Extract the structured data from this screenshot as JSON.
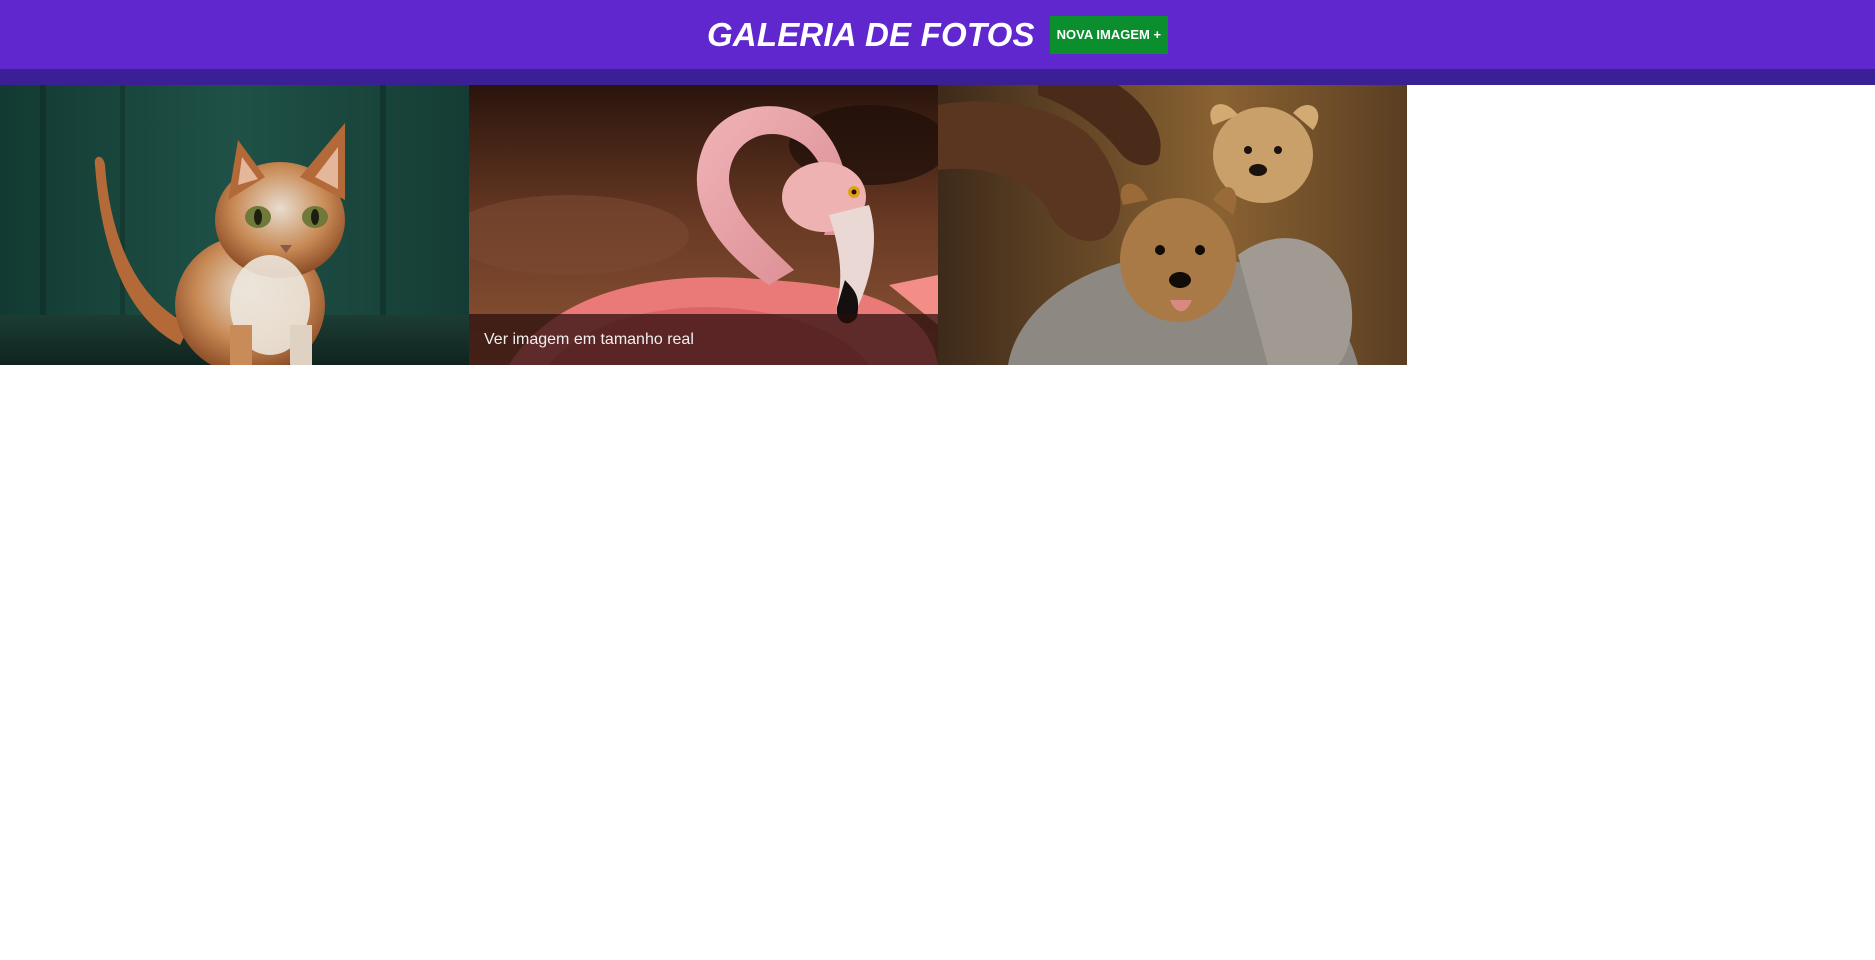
{
  "header": {
    "title": "GALERIA DE FOTOS",
    "new_button_label": "NOVA IMAGEM +"
  },
  "colors": {
    "header_bg": "#5f27cd",
    "header_strip": "#3a1f95",
    "button_bg": "#0b8f2e"
  },
  "gallery": {
    "items": [
      {
        "subject": "cat",
        "caption": ""
      },
      {
        "subject": "flamingo",
        "caption": "Ver imagem em tamanho real"
      },
      {
        "subject": "puppies",
        "caption": ""
      }
    ]
  }
}
